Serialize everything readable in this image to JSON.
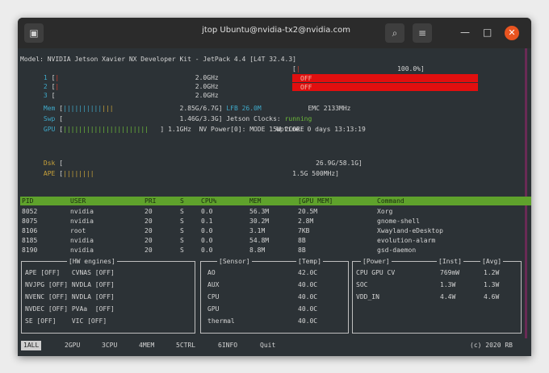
{
  "window": {
    "title": "jtop Ubuntu@nvidia-tx2@nvidia.com",
    "menu_icon": "terminal-icon",
    "controls": [
      "search-icon",
      "menu-icon",
      "minimize-icon",
      "maximize-icon",
      "close-icon"
    ]
  },
  "header": {
    "model_line": "Model: NVIDIA Jetson Xavier NX Developer Kit - JetPack 4.4 [L4T 32.4.3]",
    "cpus": [
      {
        "index": "1",
        "freq": "2.0GHz",
        "usage": "100.0%"
      },
      {
        "index": "2",
        "freq": "2.0GHz",
        "usage": "OFF"
      },
      {
        "index": "3",
        "freq": "2.0GHz",
        "usage": "OFF"
      }
    ],
    "mem": {
      "label": "Mem",
      "value": "2.85G/6.7G",
      "lfb": "LFB 26.0M",
      "emc": "EMC 2133MHz"
    },
    "swp": {
      "label": "Swp",
      "value": "1.46G/3.3G",
      "jetson_clocks_label": "Jetson Clocks:",
      "jetson_clocks_value": "running"
    },
    "gpu": {
      "label": "GPU",
      "value": "1.1GHz",
      "nv_power": "NV Power[0]: MODE 15W 2CORE",
      "uptime": "Uptime: 0 days 13:13:19"
    },
    "dsk": {
      "label": "Dsk",
      "value": "26.9G/58.1G"
    },
    "ape": {
      "label": "APE",
      "value": "1.5G 500MHz"
    }
  },
  "process_table": {
    "columns": [
      "PID",
      "USER",
      "PRI",
      "S",
      "CPU%",
      "MEM",
      "[GPU MEM]",
      "Command"
    ],
    "rows": [
      [
        "8052",
        "nvidia",
        "20",
        "S",
        "0.0",
        "56.3M",
        "20.5M",
        "Xorg"
      ],
      [
        "8075",
        "nvidia",
        "20",
        "S",
        "0.1",
        "30.2M",
        "2.8M",
        "gnome-shell"
      ],
      [
        "8106",
        "root",
        "20",
        "S",
        "0.0",
        "3.1M",
        "7KB",
        "Xwayland-eDesktop"
      ],
      [
        "8185",
        "nvidia",
        "20",
        "S",
        "0.0",
        "54.8M",
        "8B",
        "evolution-alarm"
      ],
      [
        "8190",
        "nvidia",
        "20",
        "S",
        "0.0",
        "8.8M",
        "8B",
        "gsd-daemon"
      ]
    ]
  },
  "hw_engines": {
    "title": "[HW engines]",
    "items": [
      {
        "name": "APE",
        "state": "[OFF]",
        "name2": "CVNAS",
        "state2": "[OFF]"
      },
      {
        "name": "NVJPG",
        "state": "[OFF]",
        "name2": "NVDLA",
        "state2": "[OFF]"
      },
      {
        "name": "NVENC",
        "state": "[OFF]",
        "name2": "NVDLA",
        "state2": "[OFF]"
      },
      {
        "name": "NVDEC",
        "state": "[OFF]",
        "name2": "PVAa",
        "state2": "[OFF]"
      },
      {
        "name": "SE",
        "state": "[OFF]",
        "name2": "VIC",
        "state2": "[OFF]"
      }
    ]
  },
  "sensors": {
    "title": "[Sensor]",
    "temp_title": "[Temp]",
    "items": [
      {
        "name": "AO",
        "temp": "42.0C"
      },
      {
        "name": "AUX",
        "temp": "40.0C"
      },
      {
        "name": "CPU",
        "temp": "40.0C"
      },
      {
        "name": "GPU",
        "temp": "40.0C"
      },
      {
        "name": "thermal",
        "temp": "40.0C"
      }
    ]
  },
  "power": {
    "title": "[Power]",
    "inst_title": "[Inst]",
    "avg_title": "[Avg]",
    "items": [
      {
        "name": "CPU GPU CV",
        "inst": "769mW",
        "avg": "1.2W"
      },
      {
        "name": "SOC",
        "inst": "1.3W",
        "avg": "1.3W"
      },
      {
        "name": "VDD_IN",
        "inst": "4.4W",
        "avg": "4.6W"
      }
    ]
  },
  "bottom_tabs": {
    "items": [
      "1ALL",
      "2GPU",
      "3CPU",
      "4MEM",
      "5CTRL",
      "6INFO",
      "Quit"
    ],
    "right": "(c) 2020 RB"
  }
}
